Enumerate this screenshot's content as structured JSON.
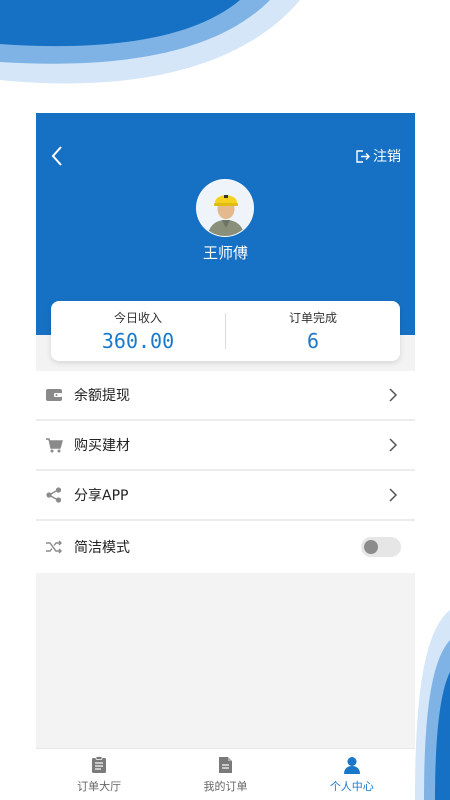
{
  "header": {
    "logout_label": "注销",
    "username": "王师傅"
  },
  "stats": {
    "income_label": "今日收入",
    "income_value": "360.00",
    "orders_label": "订单完成",
    "orders_value": "6"
  },
  "menu": {
    "items": [
      {
        "label": "余额提现",
        "icon": "wallet-icon"
      },
      {
        "label": "购买建材",
        "icon": "cart-icon"
      },
      {
        "label": "分享APP",
        "icon": "share-icon"
      },
      {
        "label": "简洁模式",
        "icon": "shuffle-icon",
        "toggle": false
      }
    ]
  },
  "tabbar": {
    "tabs": [
      {
        "label": "订单大厅",
        "icon": "clipboard-icon",
        "active": false
      },
      {
        "label": "我的订单",
        "icon": "document-icon",
        "active": false
      },
      {
        "label": "个人中心",
        "icon": "person-icon",
        "active": true
      }
    ]
  },
  "colors": {
    "primary": "#1671c4",
    "accent_text": "#1a7ac9",
    "page_bg": "#f3f3f3"
  }
}
